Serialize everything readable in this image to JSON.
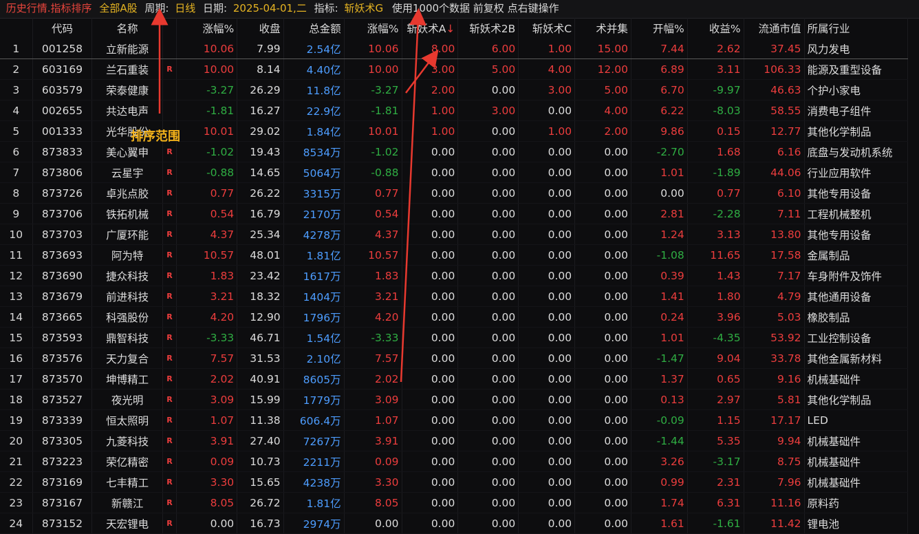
{
  "title": {
    "prefix": "历史行情.指标排序",
    "scope": "全部A股",
    "period_label": "周期:",
    "period_value": "日线",
    "date_label": "日期:",
    "date_value": "2025-04-01,二",
    "indicator_label": "指标:",
    "indicator_value": "斩妖术G",
    "info": "使用1000个数据 前复权 点右键操作"
  },
  "columns": [
    "",
    "代码",
    "名称",
    "",
    "涨幅%",
    "收盘",
    "总金额",
    "涨幅%",
    "斩妖术A",
    "斩妖术2B",
    "斩妖术C",
    "术并集",
    "开幅%",
    "收益%",
    "流通市值",
    "所属行业"
  ],
  "sort_marker": "↓",
  "annotation": "排序范围",
  "colors": {
    "red": "#ec3d3d",
    "green": "#2fae43",
    "blue": "#4d9dff",
    "yellow": "#e6b422"
  },
  "rows": [
    {
      "i": "1",
      "code": "001258",
      "name": "立新能源",
      "r": "",
      "chg": "10.06",
      "close": "7.99",
      "amt": "2.54亿",
      "chg2": "10.06",
      "a": "8.00",
      "b": "6.00",
      "c": "1.00",
      "u": "15.00",
      "open": "7.44",
      "ret": "2.62",
      "cap": "37.45",
      "ind": "风力发电"
    },
    {
      "i": "2",
      "code": "603169",
      "name": "兰石重装",
      "r": "R",
      "chg": "10.00",
      "close": "8.14",
      "amt": "4.40亿",
      "chg2": "10.00",
      "a": "3.00",
      "b": "5.00",
      "c": "4.00",
      "u": "12.00",
      "open": "6.89",
      "ret": "3.11",
      "cap": "106.33",
      "ind": "能源及重型设备"
    },
    {
      "i": "3",
      "code": "603579",
      "name": "荣泰健康",
      "r": "",
      "chg": "-3.27",
      "close": "26.29",
      "amt": "11.8亿",
      "chg2": "-3.27",
      "a": "2.00",
      "b": "0.00",
      "c": "3.00",
      "u": "5.00",
      "open": "6.70",
      "ret": "-9.97",
      "cap": "46.63",
      "ind": "个护小家电"
    },
    {
      "i": "4",
      "code": "002655",
      "name": "共达电声",
      "r": "",
      "chg": "-1.81",
      "close": "16.27",
      "amt": "22.9亿",
      "chg2": "-1.81",
      "a": "1.00",
      "b": "3.00",
      "c": "0.00",
      "u": "4.00",
      "open": "6.22",
      "ret": "-8.03",
      "cap": "58.55",
      "ind": "消费电子组件"
    },
    {
      "i": "5",
      "code": "001333",
      "name": "光华股份",
      "r": "",
      "chg": "10.01",
      "close": "29.02",
      "amt": "1.84亿",
      "chg2": "10.01",
      "a": "1.00",
      "b": "0.00",
      "c": "1.00",
      "u": "2.00",
      "open": "9.86",
      "ret": "0.15",
      "cap": "12.77",
      "ind": "其他化学制品"
    },
    {
      "i": "6",
      "code": "873833",
      "name": "美心翼申",
      "r": "R",
      "chg": "-1.02",
      "close": "19.43",
      "amt": "8534万",
      "chg2": "-1.02",
      "a": "0.00",
      "b": "0.00",
      "c": "0.00",
      "u": "0.00",
      "open": "-2.70",
      "ret": "1.68",
      "cap": "6.16",
      "ind": "底盘与发动机系统"
    },
    {
      "i": "7",
      "code": "873806",
      "name": "云星宇",
      "r": "R",
      "chg": "-0.88",
      "close": "14.65",
      "amt": "5064万",
      "chg2": "-0.88",
      "a": "0.00",
      "b": "0.00",
      "c": "0.00",
      "u": "0.00",
      "open": "1.01",
      "ret": "-1.89",
      "cap": "44.06",
      "ind": "行业应用软件"
    },
    {
      "i": "8",
      "code": "873726",
      "name": "卓兆点胶",
      "r": "R",
      "chg": "0.77",
      "close": "26.22",
      "amt": "3315万",
      "chg2": "0.77",
      "a": "0.00",
      "b": "0.00",
      "c": "0.00",
      "u": "0.00",
      "open": "0.00",
      "ret": "0.77",
      "cap": "6.10",
      "ind": "其他专用设备"
    },
    {
      "i": "9",
      "code": "873706",
      "name": "铁拓机械",
      "r": "R",
      "chg": "0.54",
      "close": "16.79",
      "amt": "2170万",
      "chg2": "0.54",
      "a": "0.00",
      "b": "0.00",
      "c": "0.00",
      "u": "0.00",
      "open": "2.81",
      "ret": "-2.28",
      "cap": "7.11",
      "ind": "工程机械整机"
    },
    {
      "i": "10",
      "code": "873703",
      "name": "广厦环能",
      "r": "R",
      "chg": "4.37",
      "close": "25.34",
      "amt": "4278万",
      "chg2": "4.37",
      "a": "0.00",
      "b": "0.00",
      "c": "0.00",
      "u": "0.00",
      "open": "1.24",
      "ret": "3.13",
      "cap": "13.80",
      "ind": "其他专用设备"
    },
    {
      "i": "11",
      "code": "873693",
      "name": "阿为特",
      "r": "R",
      "chg": "10.57",
      "close": "48.01",
      "amt": "1.81亿",
      "chg2": "10.57",
      "a": "0.00",
      "b": "0.00",
      "c": "0.00",
      "u": "0.00",
      "open": "-1.08",
      "ret": "11.65",
      "cap": "17.58",
      "ind": "金属制品"
    },
    {
      "i": "12",
      "code": "873690",
      "name": "捷众科技",
      "r": "R",
      "chg": "1.83",
      "close": "23.42",
      "amt": "1617万",
      "chg2": "1.83",
      "a": "0.00",
      "b": "0.00",
      "c": "0.00",
      "u": "0.00",
      "open": "0.39",
      "ret": "1.43",
      "cap": "7.17",
      "ind": "车身附件及饰件"
    },
    {
      "i": "13",
      "code": "873679",
      "name": "前进科技",
      "r": "R",
      "chg": "3.21",
      "close": "18.32",
      "amt": "1404万",
      "chg2": "3.21",
      "a": "0.00",
      "b": "0.00",
      "c": "0.00",
      "u": "0.00",
      "open": "1.41",
      "ret": "1.80",
      "cap": "4.79",
      "ind": "其他通用设备"
    },
    {
      "i": "14",
      "code": "873665",
      "name": "科强股份",
      "r": "R",
      "chg": "4.20",
      "close": "12.90",
      "amt": "1796万",
      "chg2": "4.20",
      "a": "0.00",
      "b": "0.00",
      "c": "0.00",
      "u": "0.00",
      "open": "0.24",
      "ret": "3.96",
      "cap": "5.03",
      "ind": "橡胶制品"
    },
    {
      "i": "15",
      "code": "873593",
      "name": "鼎智科技",
      "r": "R",
      "chg": "-3.33",
      "close": "46.71",
      "amt": "1.54亿",
      "chg2": "-3.33",
      "a": "0.00",
      "b": "0.00",
      "c": "0.00",
      "u": "0.00",
      "open": "1.01",
      "ret": "-4.35",
      "cap": "53.92",
      "ind": "工业控制设备"
    },
    {
      "i": "16",
      "code": "873576",
      "name": "天力复合",
      "r": "R",
      "chg": "7.57",
      "close": "31.53",
      "amt": "2.10亿",
      "chg2": "7.57",
      "a": "0.00",
      "b": "0.00",
      "c": "0.00",
      "u": "0.00",
      "open": "-1.47",
      "ret": "9.04",
      "cap": "33.78",
      "ind": "其他金属新材料"
    },
    {
      "i": "17",
      "code": "873570",
      "name": "坤博精工",
      "r": "R",
      "chg": "2.02",
      "close": "40.91",
      "amt": "8605万",
      "chg2": "2.02",
      "a": "0.00",
      "b": "0.00",
      "c": "0.00",
      "u": "0.00",
      "open": "1.37",
      "ret": "0.65",
      "cap": "9.16",
      "ind": "机械基础件"
    },
    {
      "i": "18",
      "code": "873527",
      "name": "夜光明",
      "r": "R",
      "chg": "3.09",
      "close": "15.99",
      "amt": "1779万",
      "chg2": "3.09",
      "a": "0.00",
      "b": "0.00",
      "c": "0.00",
      "u": "0.00",
      "open": "0.13",
      "ret": "2.97",
      "cap": "5.81",
      "ind": "其他化学制品"
    },
    {
      "i": "19",
      "code": "873339",
      "name": "恒太照明",
      "r": "R",
      "chg": "1.07",
      "close": "11.38",
      "amt": "606.4万",
      "chg2": "1.07",
      "a": "0.00",
      "b": "0.00",
      "c": "0.00",
      "u": "0.00",
      "open": "-0.09",
      "ret": "1.15",
      "cap": "17.17",
      "ind": "LED"
    },
    {
      "i": "20",
      "code": "873305",
      "name": "九菱科技",
      "r": "R",
      "chg": "3.91",
      "close": "27.40",
      "amt": "7267万",
      "chg2": "3.91",
      "a": "0.00",
      "b": "0.00",
      "c": "0.00",
      "u": "0.00",
      "open": "-1.44",
      "ret": "5.35",
      "cap": "9.94",
      "ind": "机械基础件"
    },
    {
      "i": "21",
      "code": "873223",
      "name": "荣亿精密",
      "r": "R",
      "chg": "0.09",
      "close": "10.73",
      "amt": "2211万",
      "chg2": "0.09",
      "a": "0.00",
      "b": "0.00",
      "c": "0.00",
      "u": "0.00",
      "open": "3.26",
      "ret": "-3.17",
      "cap": "8.75",
      "ind": "机械基础件"
    },
    {
      "i": "22",
      "code": "873169",
      "name": "七丰精工",
      "r": "R",
      "chg": "3.30",
      "close": "15.65",
      "amt": "4238万",
      "chg2": "3.30",
      "a": "0.00",
      "b": "0.00",
      "c": "0.00",
      "u": "0.00",
      "open": "0.99",
      "ret": "2.31",
      "cap": "7.96",
      "ind": "机械基础件"
    },
    {
      "i": "23",
      "code": "873167",
      "name": "新赣江",
      "r": "R",
      "chg": "8.05",
      "close": "26.72",
      "amt": "1.81亿",
      "chg2": "8.05",
      "a": "0.00",
      "b": "0.00",
      "c": "0.00",
      "u": "0.00",
      "open": "1.74",
      "ret": "6.31",
      "cap": "11.16",
      "ind": "原料药"
    },
    {
      "i": "24",
      "code": "873152",
      "name": "天宏锂电",
      "r": "R",
      "chg": "0.00",
      "close": "16.73",
      "amt": "2974万",
      "chg2": "0.00",
      "a": "0.00",
      "b": "0.00",
      "c": "0.00",
      "u": "0.00",
      "open": "1.61",
      "ret": "-1.61",
      "cap": "11.42",
      "ind": "锂电池"
    }
  ]
}
